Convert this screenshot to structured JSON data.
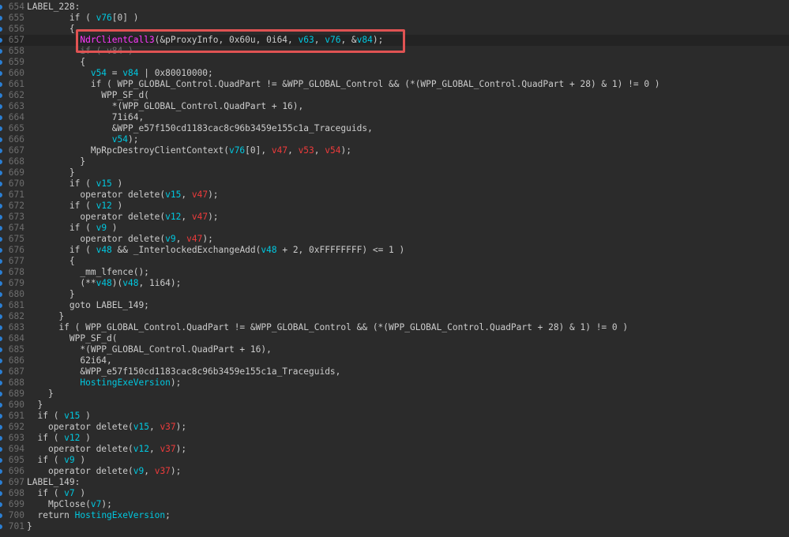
{
  "editor": {
    "colors": {
      "background": "#2b2b2b",
      "default_text": "#cccccc",
      "function_magenta": "#ff38ff",
      "variable_cyan": "#00c8e0",
      "variable_red": "#ee3b3b",
      "line_number": "#6e6e6e",
      "breakpoint_dot": "#2a7fd4",
      "highlight_box": "#e05353"
    },
    "highlighted_line": "657",
    "lines": [
      {
        "num": "654",
        "indent": "",
        "tokens": [
          [
            "LABEL_228:",
            ""
          ]
        ]
      },
      {
        "num": "655",
        "indent": "        ",
        "tokens": [
          [
            "if ( ",
            ""
          ],
          [
            "v76",
            "cyan"
          ],
          [
            "[0] )",
            ""
          ]
        ]
      },
      {
        "num": "656",
        "indent": "        ",
        "tokens": [
          [
            "{",
            ""
          ]
        ]
      },
      {
        "num": "657",
        "indent": "          ",
        "tokens": [
          [
            "NdrClientCall3",
            "func"
          ],
          [
            "(&pProxyInfo, 0x60u, 0i64, ",
            ""
          ],
          [
            "v63",
            "cyan"
          ],
          [
            ", ",
            ""
          ],
          [
            "v76",
            "cyan"
          ],
          [
            ", &",
            ""
          ],
          [
            "v84",
            "cyan"
          ],
          [
            ");",
            ""
          ]
        ]
      },
      {
        "num": "658",
        "indent": "          ",
        "tokens": [
          [
            "if ( v84 )",
            "ghost"
          ]
        ]
      },
      {
        "num": "659",
        "indent": "          ",
        "tokens": [
          [
            "{",
            ""
          ]
        ]
      },
      {
        "num": "660",
        "indent": "            ",
        "tokens": [
          [
            "v54",
            "cyan"
          ],
          [
            " = ",
            ""
          ],
          [
            "v84",
            "cyan"
          ],
          [
            " | 0x80010000;",
            ""
          ]
        ]
      },
      {
        "num": "661",
        "indent": "            ",
        "tokens": [
          [
            "if ( WPP_GLOBAL_Control.QuadPart != &WPP_GLOBAL_Control && (*(WPP_GLOBAL_Control.QuadPart + 28) & 1) != 0 )",
            ""
          ]
        ]
      },
      {
        "num": "662",
        "indent": "              ",
        "tokens": [
          [
            "WPP_SF_d(",
            ""
          ]
        ]
      },
      {
        "num": "663",
        "indent": "                ",
        "tokens": [
          [
            "*(WPP_GLOBAL_Control.QuadPart + 16),",
            ""
          ]
        ]
      },
      {
        "num": "664",
        "indent": "                ",
        "tokens": [
          [
            "71i64,",
            ""
          ]
        ]
      },
      {
        "num": "665",
        "indent": "                ",
        "tokens": [
          [
            "&WPP_e57f150cd1183cac8c96b3459e155c1a_Traceguids,",
            ""
          ]
        ]
      },
      {
        "num": "666",
        "indent": "                ",
        "tokens": [
          [
            "v54",
            "cyan"
          ],
          [
            ");",
            ""
          ]
        ]
      },
      {
        "num": "667",
        "indent": "            ",
        "tokens": [
          [
            "MpRpcDestroyClientContext(",
            ""
          ],
          [
            "v76",
            "cyan"
          ],
          [
            "[0], ",
            ""
          ],
          [
            "v47",
            "red"
          ],
          [
            ", ",
            ""
          ],
          [
            "v53",
            "red"
          ],
          [
            ", ",
            ""
          ],
          [
            "v54",
            "red"
          ],
          [
            ");",
            ""
          ]
        ]
      },
      {
        "num": "668",
        "indent": "          ",
        "tokens": [
          [
            "}",
            ""
          ]
        ]
      },
      {
        "num": "669",
        "indent": "        ",
        "tokens": [
          [
            "}",
            ""
          ]
        ]
      },
      {
        "num": "670",
        "indent": "        ",
        "tokens": [
          [
            "if ( ",
            ""
          ],
          [
            "v15",
            "cyan"
          ],
          [
            " )",
            ""
          ]
        ]
      },
      {
        "num": "671",
        "indent": "          ",
        "tokens": [
          [
            "operator delete(",
            ""
          ],
          [
            "v15",
            "cyan"
          ],
          [
            ", ",
            ""
          ],
          [
            "v47",
            "red"
          ],
          [
            ");",
            ""
          ]
        ]
      },
      {
        "num": "672",
        "indent": "        ",
        "tokens": [
          [
            "if ( ",
            ""
          ],
          [
            "v12",
            "cyan"
          ],
          [
            " )",
            ""
          ]
        ]
      },
      {
        "num": "673",
        "indent": "          ",
        "tokens": [
          [
            "operator delete(",
            ""
          ],
          [
            "v12",
            "cyan"
          ],
          [
            ", ",
            ""
          ],
          [
            "v47",
            "red"
          ],
          [
            ");",
            ""
          ]
        ]
      },
      {
        "num": "674",
        "indent": "        ",
        "tokens": [
          [
            "if ( ",
            ""
          ],
          [
            "v9",
            "cyan"
          ],
          [
            " )",
            ""
          ]
        ]
      },
      {
        "num": "675",
        "indent": "          ",
        "tokens": [
          [
            "operator delete(",
            ""
          ],
          [
            "v9",
            "cyan"
          ],
          [
            ", ",
            ""
          ],
          [
            "v47",
            "red"
          ],
          [
            ");",
            ""
          ]
        ]
      },
      {
        "num": "676",
        "indent": "        ",
        "tokens": [
          [
            "if ( ",
            ""
          ],
          [
            "v48",
            "cyan"
          ],
          [
            " && _InterlockedExchangeAdd(",
            ""
          ],
          [
            "v48",
            "cyan"
          ],
          [
            " + 2, 0xFFFFFFFF) <= 1 )",
            ""
          ]
        ]
      },
      {
        "num": "677",
        "indent": "        ",
        "tokens": [
          [
            "{",
            ""
          ]
        ]
      },
      {
        "num": "678",
        "indent": "          ",
        "tokens": [
          [
            "_mm_lfence();",
            ""
          ]
        ]
      },
      {
        "num": "679",
        "indent": "          ",
        "tokens": [
          [
            "(**",
            ""
          ],
          [
            "v48",
            "cyan"
          ],
          [
            ")(",
            ""
          ],
          [
            "v48",
            "cyan"
          ],
          [
            ", 1i64);",
            ""
          ]
        ]
      },
      {
        "num": "680",
        "indent": "        ",
        "tokens": [
          [
            "}",
            ""
          ]
        ]
      },
      {
        "num": "681",
        "indent": "        ",
        "tokens": [
          [
            "goto LABEL_149;",
            ""
          ]
        ]
      },
      {
        "num": "682",
        "indent": "      ",
        "tokens": [
          [
            "}",
            ""
          ]
        ]
      },
      {
        "num": "683",
        "indent": "      ",
        "tokens": [
          [
            "if ( WPP_GLOBAL_Control.QuadPart != &WPP_GLOBAL_Control && (*(WPP_GLOBAL_Control.QuadPart + 28) & 1) != 0 )",
            ""
          ]
        ]
      },
      {
        "num": "684",
        "indent": "        ",
        "tokens": [
          [
            "WPP_SF_d(",
            ""
          ]
        ]
      },
      {
        "num": "685",
        "indent": "          ",
        "tokens": [
          [
            "*(WPP_GLOBAL_Control.QuadPart + 16),",
            ""
          ]
        ]
      },
      {
        "num": "686",
        "indent": "          ",
        "tokens": [
          [
            "62i64,",
            ""
          ]
        ]
      },
      {
        "num": "687",
        "indent": "          ",
        "tokens": [
          [
            "&WPP_e57f150cd1183cac8c96b3459e155c1a_Traceguids,",
            ""
          ]
        ]
      },
      {
        "num": "688",
        "indent": "          ",
        "tokens": [
          [
            "HostingExeVersion",
            "cyan"
          ],
          [
            ");",
            ""
          ]
        ]
      },
      {
        "num": "689",
        "indent": "    ",
        "tokens": [
          [
            "}",
            ""
          ]
        ]
      },
      {
        "num": "690",
        "indent": "  ",
        "tokens": [
          [
            "}",
            ""
          ]
        ]
      },
      {
        "num": "691",
        "indent": "  ",
        "tokens": [
          [
            "if ( ",
            ""
          ],
          [
            "v15",
            "cyan"
          ],
          [
            " )",
            ""
          ]
        ]
      },
      {
        "num": "692",
        "indent": "    ",
        "tokens": [
          [
            "operator delete(",
            ""
          ],
          [
            "v15",
            "cyan"
          ],
          [
            ", ",
            ""
          ],
          [
            "v37",
            "red"
          ],
          [
            ");",
            ""
          ]
        ]
      },
      {
        "num": "693",
        "indent": "  ",
        "tokens": [
          [
            "if ( ",
            ""
          ],
          [
            "v12",
            "cyan"
          ],
          [
            " )",
            ""
          ]
        ]
      },
      {
        "num": "694",
        "indent": "    ",
        "tokens": [
          [
            "operator delete(",
            ""
          ],
          [
            "v12",
            "cyan"
          ],
          [
            ", ",
            ""
          ],
          [
            "v37",
            "red"
          ],
          [
            ");",
            ""
          ]
        ]
      },
      {
        "num": "695",
        "indent": "  ",
        "tokens": [
          [
            "if ( ",
            ""
          ],
          [
            "v9",
            "cyan"
          ],
          [
            " )",
            ""
          ]
        ]
      },
      {
        "num": "696",
        "indent": "    ",
        "tokens": [
          [
            "operator delete(",
            ""
          ],
          [
            "v9",
            "cyan"
          ],
          [
            ", ",
            ""
          ],
          [
            "v37",
            "red"
          ],
          [
            ");",
            ""
          ]
        ]
      },
      {
        "num": "697",
        "indent": "",
        "tokens": [
          [
            "LABEL_149:",
            ""
          ]
        ]
      },
      {
        "num": "698",
        "indent": "  ",
        "tokens": [
          [
            "if ( ",
            ""
          ],
          [
            "v7",
            "cyan"
          ],
          [
            " )",
            ""
          ]
        ]
      },
      {
        "num": "699",
        "indent": "    ",
        "tokens": [
          [
            "MpClose(",
            ""
          ],
          [
            "v7",
            "cyan"
          ],
          [
            ");",
            ""
          ]
        ]
      },
      {
        "num": "700",
        "indent": "  ",
        "tokens": [
          [
            "return ",
            ""
          ],
          [
            "HostingExeVersion",
            "cyan"
          ],
          [
            ";",
            ""
          ]
        ]
      },
      {
        "num": "701",
        "indent": "",
        "tokens": [
          [
            "}",
            ""
          ]
        ]
      }
    ]
  }
}
